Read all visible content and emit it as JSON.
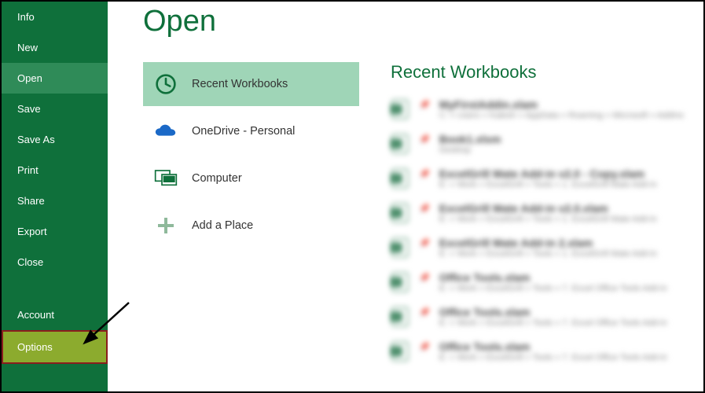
{
  "sidebar": {
    "items": [
      {
        "label": "Info"
      },
      {
        "label": "New"
      },
      {
        "label": "Open"
      },
      {
        "label": "Save"
      },
      {
        "label": "Save As"
      },
      {
        "label": "Print"
      },
      {
        "label": "Share"
      },
      {
        "label": "Export"
      },
      {
        "label": "Close"
      }
    ],
    "account_label": "Account",
    "options_label": "Options"
  },
  "page": {
    "title": "Open"
  },
  "locations": {
    "recent": "Recent Workbooks",
    "onedrive": "OneDrive - Personal",
    "computer": "Computer",
    "addplace": "Add a Place"
  },
  "recent": {
    "heading": "Recent Workbooks",
    "items": [
      {
        "name": "MyFirstAddin.xlam",
        "path": "C: » Users » Kalesh » AppData » Roaming » Microsoft » AddIns"
      },
      {
        "name": "Book1.xlsm",
        "path": "Desktop"
      },
      {
        "name": "ExcelGrill Mate Add-in v2.0 - Copy.xlam",
        "path": "E: » Work » ExcelGrill » Tools » 1. ExcelGrill Mate Add-in"
      },
      {
        "name": "ExcelGrill Mate Add-in v2.0.xlam",
        "path": "E: » Work » ExcelGrill » Tools » 1. ExcelGrill Mate Add-in"
      },
      {
        "name": "ExcelGrill Mate Add-in 2.xlam",
        "path": "E: » Work » ExcelGrill » Tools » 1. ExcelGrill Mate Add-in"
      },
      {
        "name": "Office Tools.xlam",
        "path": "E: » Work » ExcelGrill » Tools » 7. Excel Office Tools Add-in"
      },
      {
        "name": "Office Tools.xlam",
        "path": "E: » Work » ExcelGrill » Tools » 7. Excel Office Tools Add-in"
      },
      {
        "name": "Office Tools.xlam",
        "path": "E: » Work » ExcelGrill » Tools » 7. Excel Office Tools Add-in"
      }
    ]
  }
}
